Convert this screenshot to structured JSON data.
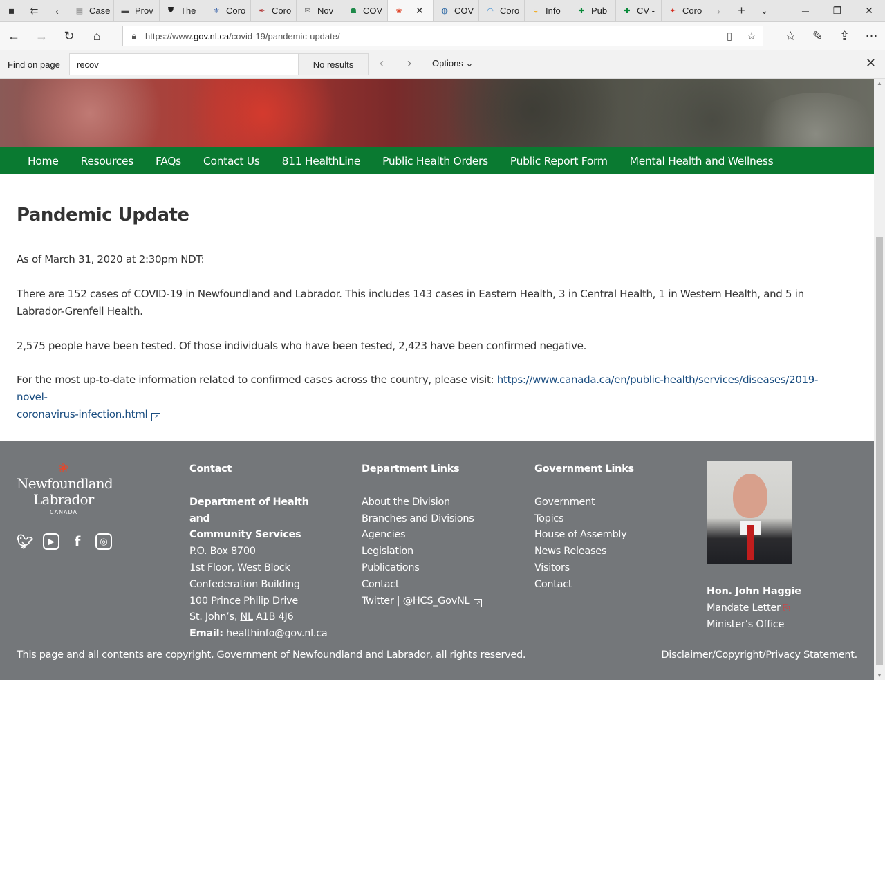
{
  "browser": {
    "tabs": [
      {
        "label": "Case",
        "icon": "page-icon",
        "color": "#777777"
      },
      {
        "label": "Prov",
        "icon": "bus-icon",
        "color": "#444444"
      },
      {
        "label": "The",
        "icon": "shield-icon",
        "color": "#222222"
      },
      {
        "label": "Coro",
        "icon": "fleur-de-lis-icon",
        "color": "#1f4fa0"
      },
      {
        "label": "Coro",
        "icon": "pen-icon",
        "color": "#b03030"
      },
      {
        "label": "Nov",
        "icon": "mail-icon",
        "color": "#666666"
      },
      {
        "label": "COV",
        "icon": "crowd-icon",
        "color": "#1e8a4a"
      },
      {
        "label": "",
        "icon": "flower-icon",
        "color": "#e04a2f",
        "active": true
      },
      {
        "label": "COV",
        "icon": "globe-icon",
        "color": "#1f5fa0"
      },
      {
        "label": "Coro",
        "icon": "wave-icon",
        "color": "#3a8ad0"
      },
      {
        "label": "Info",
        "icon": "sun-icon",
        "color": "#f0b030"
      },
      {
        "label": "Pub",
        "icon": "cross-icon",
        "color": "#0a8a3a"
      },
      {
        "label": "CV -",
        "icon": "cross-icon",
        "color": "#0a8a3a"
      },
      {
        "label": "Coro",
        "icon": "maple-leaf-icon",
        "color": "#d52b1e"
      }
    ],
    "url_prefix": "https://www.",
    "url_domain": "gov.nl.ca",
    "url_path": "/covid-19/pandemic-update/",
    "find": {
      "label": "Find on page",
      "query": "recov",
      "results": "No results",
      "options": "Options"
    }
  },
  "nav": {
    "items": [
      "Home",
      "Resources",
      "FAQs",
      "Contact Us",
      "811 HealthLine",
      "Public Health Orders",
      "Public Report Form",
      "Mental Health and Wellness"
    ]
  },
  "page": {
    "title": "Pandemic Update",
    "as_of": "As of March 31, 2020 at 2:30pm NDT:",
    "cases": "There are 152 cases of COVID-19 in Newfoundland and Labrador. This includes 143 cases in Eastern Health, 3 in Central Health, 1 in Western Health, and 5 in Labrador-Grenfell Health.",
    "tested": "2,575 people have been tested. Of those individuals who have been tested, 2,423 have been confirmed negative.",
    "info_text": "For the most up-to-date information related to confirmed cases across the country, please visit: ",
    "info_link_1": "https://www.canada.ca/en/public-health/services/diseases/2019-novel-",
    "info_link_2": "coronavirus-infection.html"
  },
  "footer": {
    "logo": {
      "line1": "Newfoundland",
      "line2": "Labrador",
      "line3": "CANADA"
    },
    "contact": {
      "heading": "Contact",
      "dept_line1": "Department of Health and",
      "dept_line2": "Community Services",
      "lines": [
        "P.O. Box 8700",
        "1st Floor, West Block",
        "Confederation Building",
        "100 Prince Philip Drive"
      ],
      "city": "St. John’s, ",
      "province": "NL",
      "postal": " A1B 4J6",
      "email_label": "Email:",
      "email": " healthinfo@gov.nl.ca"
    },
    "dept_links": {
      "heading": "Department Links",
      "items": [
        "About the Division",
        "Branches and Divisions",
        "Agencies",
        "Legislation",
        "Publications",
        "Contact"
      ],
      "twitter": "Twitter | @HCS_GovNL"
    },
    "gov_links": {
      "heading": "Government Links",
      "items": [
        "Government",
        "Topics",
        "House of Assembly",
        "News Releases",
        "Visitors",
        "Contact"
      ]
    },
    "minister": {
      "name": "Hon. John Haggie",
      "mandate": "Mandate Letter",
      "office": "Minister’s Office"
    },
    "copyright": "This page and all contents are copyright, Government of Newfoundland and Labrador, all rights reserved.",
    "disclaimer": "Disclaimer/Copyright/Privacy Statement."
  },
  "colors": {
    "nav_green": "#0a7a31",
    "footer_gray": "#74777a",
    "link_blue": "#1a4d80"
  }
}
